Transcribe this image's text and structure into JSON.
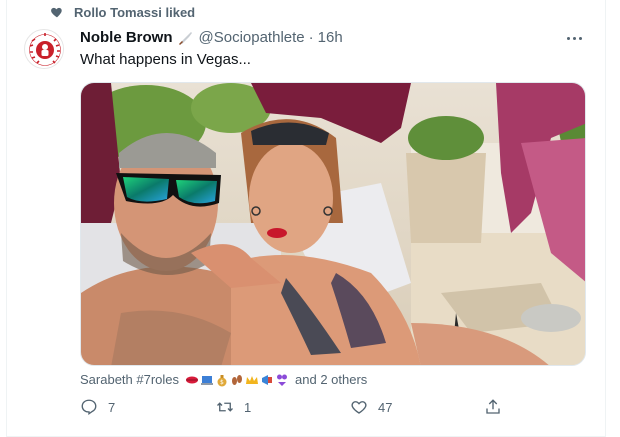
{
  "social_context": {
    "text": "Rollo Tomassi liked",
    "icon": "heart-icon"
  },
  "tweet": {
    "avatar_text": "SOCIOPATHLETE",
    "display_name": "Noble Brown",
    "name_emoji": "knife-emoji",
    "handle": "@Sociopathlete",
    "separator": "·",
    "time": "16h",
    "text": "What happens in Vegas...",
    "media_alt": "photo"
  },
  "reactions": {
    "name": "Sarabeth #7roles",
    "emojis": [
      "lips-emoji",
      "laptop-emoji",
      "money-bag-emoji",
      "footprints-emoji",
      "crown-emoji",
      "megaphone-emoji",
      "bikini-emoji"
    ],
    "others": "and 2 others"
  },
  "actions": {
    "reply_count": "7",
    "retweet_count": "1",
    "like_count": "47",
    "share_label": ""
  },
  "colors": {
    "secondary_text": "#536471",
    "primary_text": "#0f1419",
    "border": "#eff3f4"
  }
}
